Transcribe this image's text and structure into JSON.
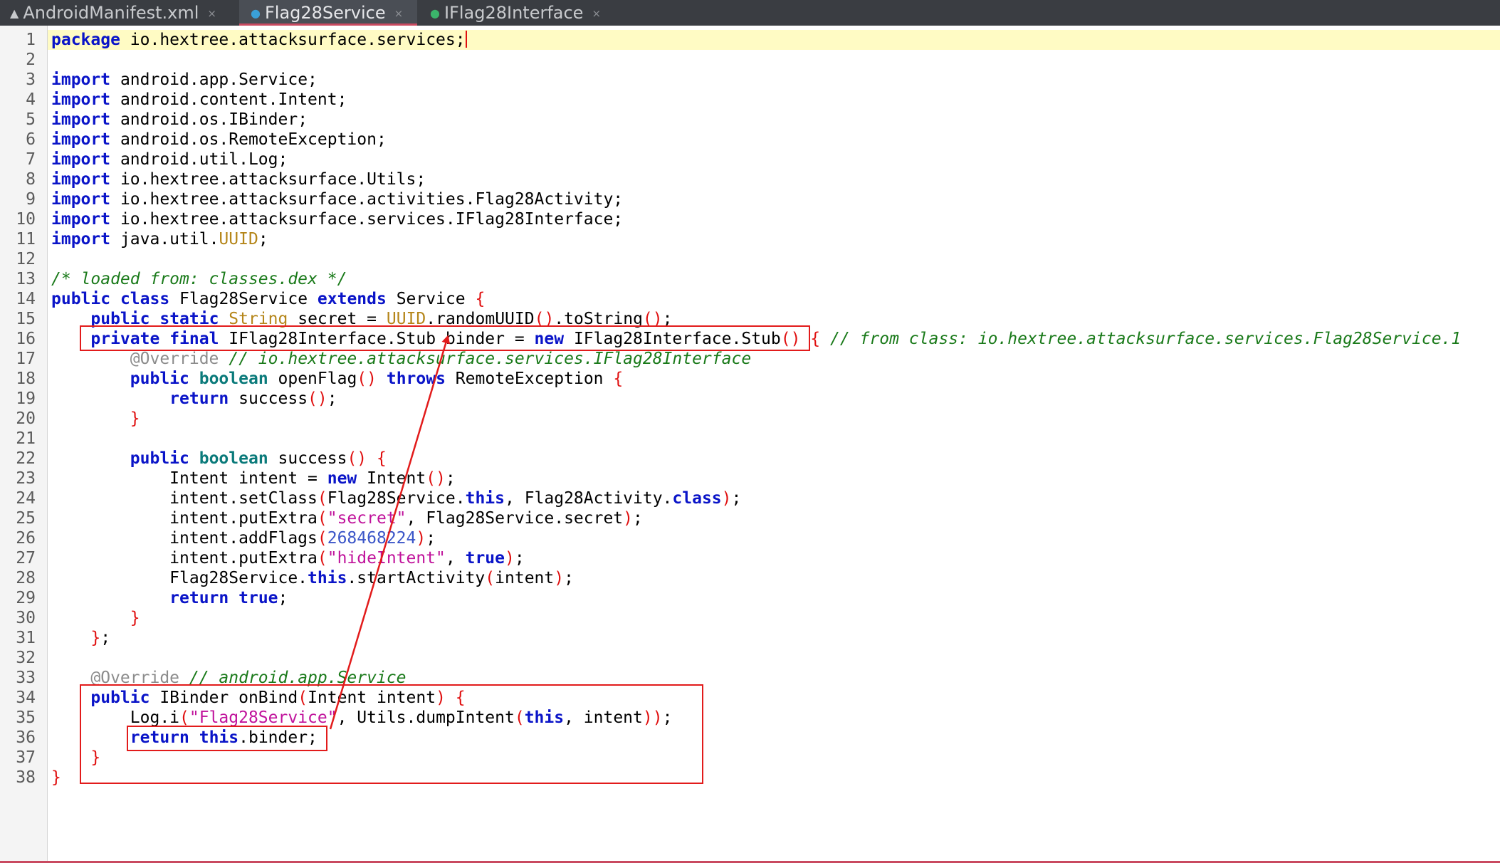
{
  "tabs": [
    {
      "label": "AndroidManifest.xml",
      "icon": "xml-file-icon",
      "active": false
    },
    {
      "label": "Flag28Service",
      "icon": "class-file-icon",
      "active": true
    },
    {
      "label": "IFlag28Interface",
      "icon": "interface-file-icon",
      "active": false
    }
  ],
  "tab_close_glyph": "×",
  "colors": {
    "keyword": "#0a14c8",
    "type": "#0a7a7a",
    "comment": "#1a7a1a",
    "string": "#c0129b",
    "number": "#3a55c8",
    "paren": "#e01010",
    "annotation": "#8c8c8c",
    "highlight_box": "#e21b1b",
    "current_line": "#fffbc4"
  },
  "code_lines": [
    {
      "n": "1",
      "tokens": [
        [
          "kw",
          "package"
        ],
        [
          "pl",
          " io.hextree.attacksurface.services;"
        ]
      ],
      "caret": true
    },
    {
      "n": "2",
      "tokens": []
    },
    {
      "n": "3",
      "tokens": [
        [
          "kw",
          "import"
        ],
        [
          "pl",
          " android.app.Service;"
        ]
      ]
    },
    {
      "n": "4",
      "tokens": [
        [
          "kw",
          "import"
        ],
        [
          "pl",
          " android.content.Intent;"
        ]
      ]
    },
    {
      "n": "5",
      "tokens": [
        [
          "kw",
          "import"
        ],
        [
          "pl",
          " android.os.IBinder;"
        ]
      ]
    },
    {
      "n": "6",
      "tokens": [
        [
          "kw",
          "import"
        ],
        [
          "pl",
          " android.os.RemoteException;"
        ]
      ]
    },
    {
      "n": "7",
      "tokens": [
        [
          "kw",
          "import"
        ],
        [
          "pl",
          " android.util.Log;"
        ]
      ]
    },
    {
      "n": "8",
      "tokens": [
        [
          "kw",
          "import"
        ],
        [
          "pl",
          " io.hextree.attacksurface.Utils;"
        ]
      ]
    },
    {
      "n": "9",
      "tokens": [
        [
          "kw",
          "import"
        ],
        [
          "pl",
          " io.hextree.attacksurface.activities.Flag28Activity;"
        ]
      ]
    },
    {
      "n": "10",
      "tokens": [
        [
          "kw",
          "import"
        ],
        [
          "pl",
          " io.hextree.attacksurface.services.IFlag28Interface;"
        ]
      ]
    },
    {
      "n": "11",
      "tokens": [
        [
          "kw",
          "import"
        ],
        [
          "pl",
          " java.util."
        ],
        [
          "ty2",
          "UUID"
        ],
        [
          "pl",
          ";"
        ]
      ]
    },
    {
      "n": "12",
      "tokens": []
    },
    {
      "n": "13",
      "tokens": [
        [
          "cm",
          "/* loaded from: classes.dex */"
        ]
      ]
    },
    {
      "n": "14",
      "tokens": [
        [
          "kw",
          "public"
        ],
        [
          "pl",
          " "
        ],
        [
          "kw",
          "class"
        ],
        [
          "pl",
          " Flag28Service "
        ],
        [
          "kw",
          "extends"
        ],
        [
          "pl",
          " Service "
        ],
        [
          "pa",
          "{"
        ]
      ]
    },
    {
      "n": "15",
      "tokens": [
        [
          "pl",
          "    "
        ],
        [
          "kw",
          "public"
        ],
        [
          "pl",
          " "
        ],
        [
          "kw",
          "static"
        ],
        [
          "pl",
          " "
        ],
        [
          "ty2",
          "String"
        ],
        [
          "pl",
          " secret = "
        ],
        [
          "ty2",
          "UUID"
        ],
        [
          "pl",
          ".randomUUID"
        ],
        [
          "pa",
          "()"
        ],
        [
          "pl",
          ".toString"
        ],
        [
          "pa",
          "()"
        ],
        [
          "pl",
          ";"
        ]
      ]
    },
    {
      "n": "16",
      "tokens": [
        [
          "pl",
          "    "
        ],
        [
          "kw",
          "private"
        ],
        [
          "pl",
          " "
        ],
        [
          "kw",
          "final"
        ],
        [
          "pl",
          " IFlag28Interface.Stub binder = "
        ],
        [
          "kw",
          "new"
        ],
        [
          "pl",
          " IFlag28Interface.Stub"
        ],
        [
          "pa",
          "()"
        ],
        [
          "pl",
          " "
        ],
        [
          "pa",
          "{"
        ],
        [
          "pl",
          " "
        ],
        [
          "cm",
          "// from class: io.hextree.attacksurface.services.Flag28Service.1"
        ]
      ]
    },
    {
      "n": "17",
      "tokens": [
        [
          "pl",
          "        "
        ],
        [
          "an",
          "@Override"
        ],
        [
          "pl",
          " "
        ],
        [
          "cm",
          "// io.hextree.attacksurface.services.IFlag28Interface"
        ]
      ]
    },
    {
      "n": "18",
      "tokens": [
        [
          "pl",
          "        "
        ],
        [
          "kw",
          "public"
        ],
        [
          "pl",
          " "
        ],
        [
          "ty",
          "boolean"
        ],
        [
          "pl",
          " openFlag"
        ],
        [
          "pa",
          "()"
        ],
        [
          "pl",
          " "
        ],
        [
          "kw",
          "throws"
        ],
        [
          "pl",
          " RemoteException "
        ],
        [
          "pa",
          "{"
        ]
      ]
    },
    {
      "n": "19",
      "tokens": [
        [
          "pl",
          "            "
        ],
        [
          "kw",
          "return"
        ],
        [
          "pl",
          " success"
        ],
        [
          "pa",
          "()"
        ],
        [
          "pl",
          ";"
        ]
      ]
    },
    {
      "n": "20",
      "tokens": [
        [
          "pl",
          "        "
        ],
        [
          "pa",
          "}"
        ]
      ]
    },
    {
      "n": "21",
      "tokens": []
    },
    {
      "n": "22",
      "tokens": [
        [
          "pl",
          "        "
        ],
        [
          "kw",
          "public"
        ],
        [
          "pl",
          " "
        ],
        [
          "ty",
          "boolean"
        ],
        [
          "pl",
          " success"
        ],
        [
          "pa",
          "()"
        ],
        [
          "pl",
          " "
        ],
        [
          "pa",
          "{"
        ]
      ]
    },
    {
      "n": "23",
      "tokens": [
        [
          "pl",
          "            Intent intent = "
        ],
        [
          "kw",
          "new"
        ],
        [
          "pl",
          " Intent"
        ],
        [
          "pa",
          "()"
        ],
        [
          "pl",
          ";"
        ]
      ]
    },
    {
      "n": "24",
      "tokens": [
        [
          "pl",
          "            intent.setClass"
        ],
        [
          "pa",
          "("
        ],
        [
          "pl",
          "Flag28Service."
        ],
        [
          "kw",
          "this"
        ],
        [
          "pl",
          ", Flag28Activity."
        ],
        [
          "kw",
          "class"
        ],
        [
          "pa",
          ")"
        ],
        [
          "pl",
          ";"
        ]
      ]
    },
    {
      "n": "25",
      "tokens": [
        [
          "pl",
          "            intent.putExtra"
        ],
        [
          "pa",
          "("
        ],
        [
          "st",
          "\"secret\""
        ],
        [
          "pl",
          ", Flag28Service.secret"
        ],
        [
          "pa",
          ")"
        ],
        [
          "pl",
          ";"
        ]
      ]
    },
    {
      "n": "26",
      "tokens": [
        [
          "pl",
          "            intent.addFlags"
        ],
        [
          "pa",
          "("
        ],
        [
          "nm",
          "268468224"
        ],
        [
          "pa",
          ")"
        ],
        [
          "pl",
          ";"
        ]
      ]
    },
    {
      "n": "27",
      "tokens": [
        [
          "pl",
          "            intent.putExtra"
        ],
        [
          "pa",
          "("
        ],
        [
          "st",
          "\"hideIntent\""
        ],
        [
          "pl",
          ", "
        ],
        [
          "kw",
          "true"
        ],
        [
          "pa",
          ")"
        ],
        [
          "pl",
          ";"
        ]
      ]
    },
    {
      "n": "28",
      "tokens": [
        [
          "pl",
          "            Flag28Service."
        ],
        [
          "kw",
          "this"
        ],
        [
          "pl",
          ".startActivity"
        ],
        [
          "pa",
          "("
        ],
        [
          "pl",
          "intent"
        ],
        [
          "pa",
          ")"
        ],
        [
          "pl",
          ";"
        ]
      ]
    },
    {
      "n": "29",
      "tokens": [
        [
          "pl",
          "            "
        ],
        [
          "kw",
          "return"
        ],
        [
          "pl",
          " "
        ],
        [
          "kw",
          "true"
        ],
        [
          "pl",
          ";"
        ]
      ]
    },
    {
      "n": "30",
      "tokens": [
        [
          "pl",
          "        "
        ],
        [
          "pa",
          "}"
        ]
      ]
    },
    {
      "n": "31",
      "tokens": [
        [
          "pl",
          "    "
        ],
        [
          "pa",
          "}"
        ],
        [
          "pl",
          ";"
        ]
      ]
    },
    {
      "n": "32",
      "tokens": []
    },
    {
      "n": "33",
      "tokens": [
        [
          "pl",
          "    "
        ],
        [
          "an",
          "@Override"
        ],
        [
          "pl",
          " "
        ],
        [
          "cm",
          "// android.app.Service"
        ]
      ]
    },
    {
      "n": "34",
      "tokens": [
        [
          "pl",
          "    "
        ],
        [
          "kw",
          "public"
        ],
        [
          "pl",
          " IBinder onBind"
        ],
        [
          "pa",
          "("
        ],
        [
          "pl",
          "Intent intent"
        ],
        [
          "pa",
          ")"
        ],
        [
          "pl",
          " "
        ],
        [
          "pa",
          "{"
        ]
      ]
    },
    {
      "n": "35",
      "tokens": [
        [
          "pl",
          "        Log.i"
        ],
        [
          "pa",
          "("
        ],
        [
          "st",
          "\"Flag28Service\""
        ],
        [
          "pl",
          ", Utils.dumpIntent"
        ],
        [
          "pa",
          "("
        ],
        [
          "kw",
          "this"
        ],
        [
          "pl",
          ", intent"
        ],
        [
          "pa",
          "))"
        ],
        [
          "pl",
          ";"
        ]
      ]
    },
    {
      "n": "36",
      "tokens": [
        [
          "pl",
          "        "
        ],
        [
          "kw",
          "return"
        ],
        [
          "pl",
          " "
        ],
        [
          "kw",
          "this"
        ],
        [
          "pl",
          ".binder;"
        ]
      ]
    },
    {
      "n": "37",
      "tokens": [
        [
          "pl",
          "    "
        ],
        [
          "pa",
          "}"
        ]
      ]
    },
    {
      "n": "38",
      "tokens": [
        [
          "pa",
          "}"
        ]
      ]
    }
  ]
}
